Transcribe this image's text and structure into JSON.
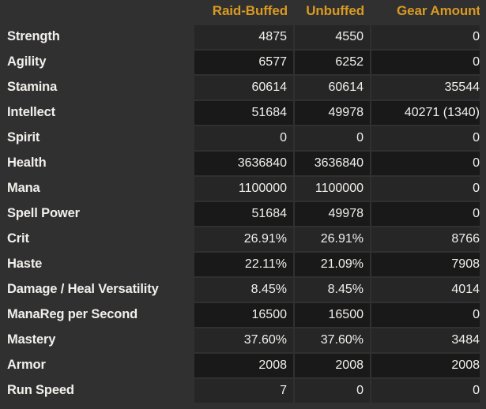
{
  "table": {
    "columns": [
      {
        "key": "label",
        "label": "",
        "align": "left"
      },
      {
        "key": "raid_buffed",
        "label": "Raid-Buffed",
        "align": "right"
      },
      {
        "key": "unbuffed",
        "label": "Unbuffed",
        "align": "right"
      },
      {
        "key": "gear_amount",
        "label": "Gear Amount",
        "align": "right"
      }
    ],
    "header_color": "#d99a23",
    "rows": [
      {
        "label": "Strength",
        "raid_buffed": "4875",
        "unbuffed": "4550",
        "gear_amount": "0"
      },
      {
        "label": "Agility",
        "raid_buffed": "6577",
        "unbuffed": "6252",
        "gear_amount": "0"
      },
      {
        "label": "Stamina",
        "raid_buffed": "60614",
        "unbuffed": "60614",
        "gear_amount": "35544"
      },
      {
        "label": "Intellect",
        "raid_buffed": "51684",
        "unbuffed": "49978",
        "gear_amount": "40271 (1340)"
      },
      {
        "label": "Spirit",
        "raid_buffed": "0",
        "unbuffed": "0",
        "gear_amount": "0"
      },
      {
        "label": "Health",
        "raid_buffed": "3636840",
        "unbuffed": "3636840",
        "gear_amount": "0"
      },
      {
        "label": "Mana",
        "raid_buffed": "1100000",
        "unbuffed": "1100000",
        "gear_amount": "0"
      },
      {
        "label": "Spell Power",
        "raid_buffed": "51684",
        "unbuffed": "49978",
        "gear_amount": "0"
      },
      {
        "label": "Crit",
        "raid_buffed": "26.91%",
        "unbuffed": "26.91%",
        "gear_amount": "8766"
      },
      {
        "label": "Haste",
        "raid_buffed": "22.11%",
        "unbuffed": "21.09%",
        "gear_amount": "7908"
      },
      {
        "label": "Damage / Heal Versatility",
        "raid_buffed": "8.45%",
        "unbuffed": "8.45%",
        "gear_amount": "4014"
      },
      {
        "label": "ManaReg per Second",
        "raid_buffed": "16500",
        "unbuffed": "16500",
        "gear_amount": "0"
      },
      {
        "label": "Mastery",
        "raid_buffed": "37.60%",
        "unbuffed": "37.60%",
        "gear_amount": "3484"
      },
      {
        "label": "Armor",
        "raid_buffed": "2008",
        "unbuffed": "2008",
        "gear_amount": "2008"
      },
      {
        "label": "Run Speed",
        "raid_buffed": "7",
        "unbuffed": "0",
        "gear_amount": "0"
      }
    ]
  }
}
